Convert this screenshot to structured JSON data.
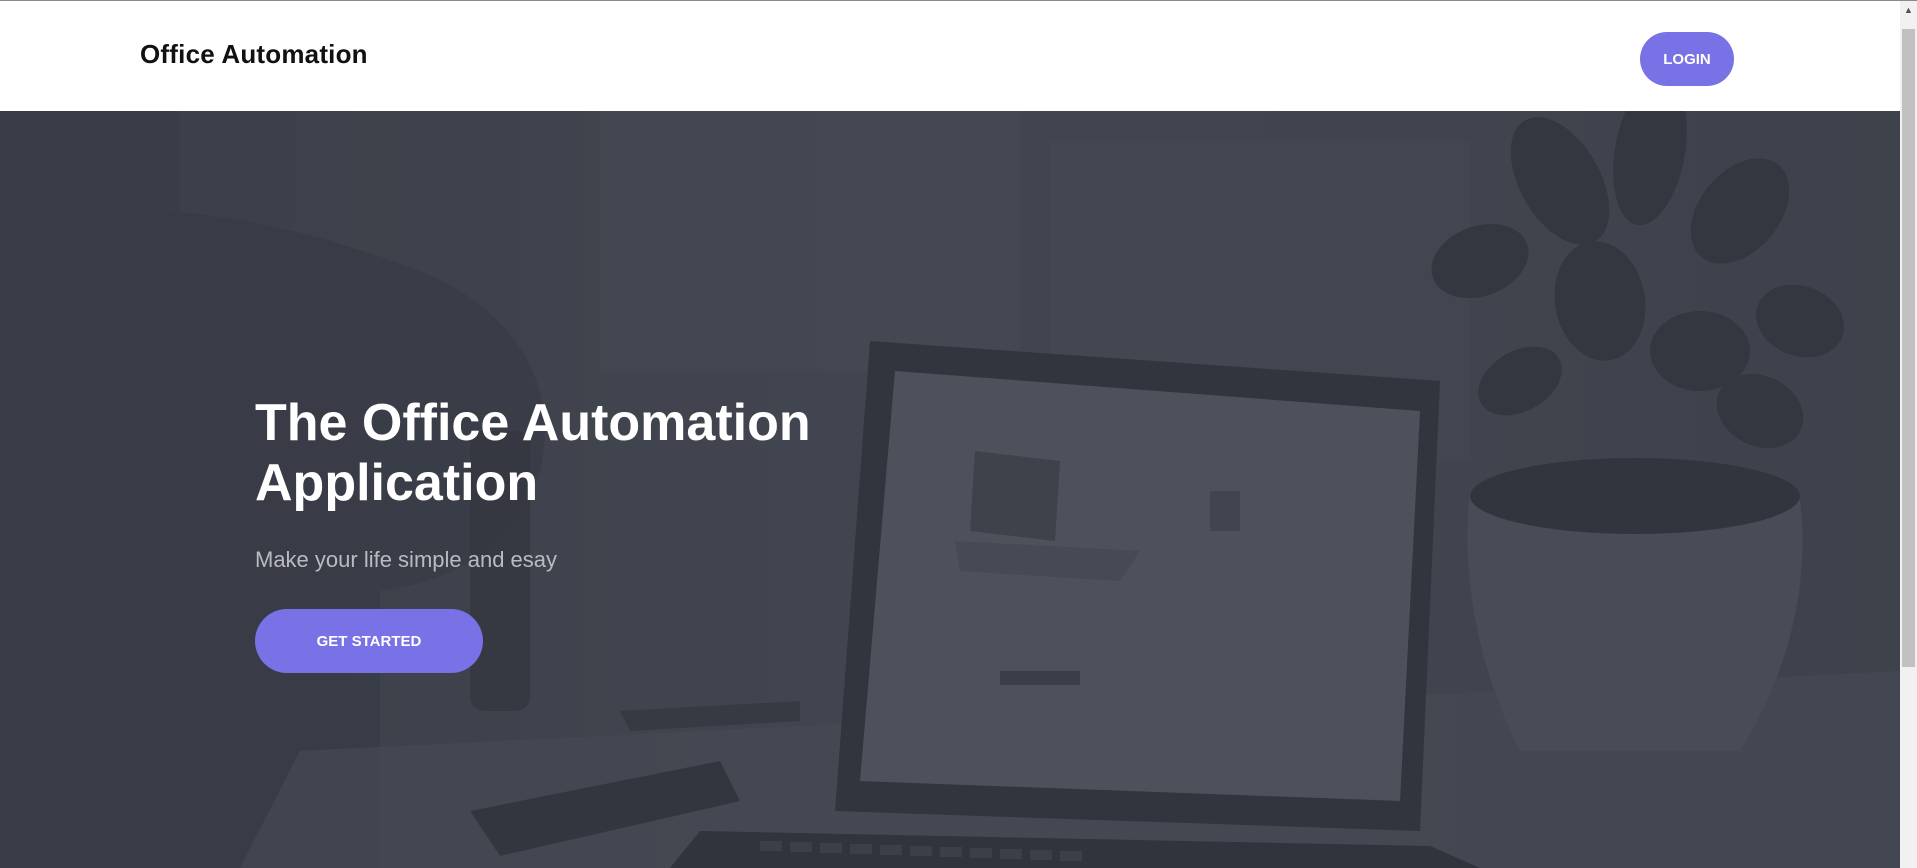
{
  "navbar": {
    "brand": "Office Automation",
    "login_label": "LOGIN"
  },
  "hero": {
    "title_line1": "The Office Automation",
    "title_line2": "Application",
    "subtitle": "Make your life simple and esay",
    "cta_label": "GET STARTED"
  },
  "colors": {
    "accent": "#7872e6",
    "hero_overlay": "#3f434d",
    "navbar_bg": "#ffffff",
    "brand_text": "#111111"
  },
  "icons": {
    "scroll_up": "scroll-up-arrow-icon"
  }
}
